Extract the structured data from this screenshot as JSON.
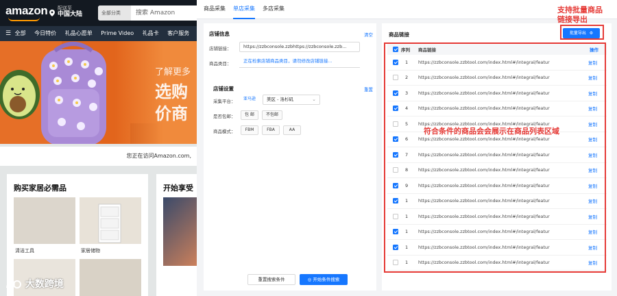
{
  "amazon": {
    "logo": "amazon",
    "deliver_label": "配送至",
    "deliver_location": "中国大陆",
    "category": "全部分类",
    "search_placeholder": "搜索 Amazon",
    "nav": [
      "全部",
      "今日特价",
      "礼品心愿单",
      "Prime Video",
      "礼品卡",
      "客户服务"
    ],
    "hero_line1": "了解更多",
    "hero_line2": "选购",
    "hero_line3": "价商",
    "visiting_text": "您正在访问Amazon.com,",
    "card1_title": "购买家居必需品",
    "card1_captions": [
      "清洁工具",
      "家居储物"
    ],
    "card2_title": "开始享受",
    "watermark": "大数跨境"
  },
  "tabs": [
    {
      "label": "商品采集",
      "active": false
    },
    {
      "label": "单店采集",
      "active": true
    },
    {
      "label": "多店采集",
      "active": false
    }
  ],
  "store_info": {
    "title": "店铺信息",
    "clear_link": "清空",
    "link_label": "店铺链接：",
    "link_value": "https://zzbconsole.zzbhttps://zzbconsole.zzb...",
    "category_label": "商品类目：",
    "category_value": "正在检索店铺商品类目，请勿修改店铺链接..."
  },
  "store_settings": {
    "title": "店铺设置",
    "reset_link": "重置",
    "platform_label": "采集平台：",
    "platform_value": "亚马逊",
    "region_value": "美区 - 洛杉矶",
    "free_shipping_label": "是否包邮：",
    "free_shipping_options": [
      "包 邮",
      "不包邮"
    ],
    "mode_label": "商品模式：",
    "mode_options": [
      "FBM",
      "FBA",
      "AA"
    ]
  },
  "buttons": {
    "reset": "重置搜索条件",
    "search": "开始条件搜索",
    "export": "批量导出"
  },
  "product_links": {
    "title": "商品链接",
    "headers": {
      "index": "序列",
      "link": "商品链接",
      "action": "操作"
    },
    "action_label": "复制",
    "rows": [
      {
        "checked": true,
        "index": "1",
        "url": "https://zzbconsole.zzbtool.com/index.html#/integral/featur"
      },
      {
        "checked": false,
        "index": "2",
        "url": "https://zzbconsole.zzbtool.com/index.html#/integral/featur"
      },
      {
        "checked": true,
        "index": "3",
        "url": "https://zzbconsole.zzbtool.com/index.html#/integral/featur"
      },
      {
        "checked": true,
        "index": "4",
        "url": "https://zzbconsole.zzbtool.com/index.html#/integral/featur"
      },
      {
        "checked": false,
        "index": "5",
        "url": "https://zzbconsole.zzbtool.com/index.html#/integral/featur"
      },
      {
        "checked": true,
        "index": "6",
        "url": "https://zzbconsole.zzbtool.com/index.html#/integral/featur"
      },
      {
        "checked": true,
        "index": "7",
        "url": "https://zzbconsole.zzbtool.com/index.html#/integral/featur"
      },
      {
        "checked": false,
        "index": "8",
        "url": "https://zzbconsole.zzbtool.com/index.html#/integral/featur"
      },
      {
        "checked": true,
        "index": "9",
        "url": "https://zzbconsole.zzbtool.com/index.html#/integral/featur"
      },
      {
        "checked": true,
        "index": "1",
        "url": "https://zzbconsole.zzbtool.com/index.html#/integral/featur"
      },
      {
        "checked": false,
        "index": "1",
        "url": "https://zzbconsole.zzbtool.com/index.html#/integral/featur"
      },
      {
        "checked": true,
        "index": "1",
        "url": "https://zzbconsole.zzbtool.com/index.html#/integral/featur"
      },
      {
        "checked": true,
        "index": "1",
        "url": "https://zzbconsole.zzbtool.com/index.html#/integral/featur"
      },
      {
        "checked": false,
        "index": "1",
        "url": "https://zzbconsole.zzbtool.com/index.html#/integral/featur"
      }
    ]
  },
  "annotations": {
    "export_note_line1": "支持批量商品",
    "export_note_line2": "链接导出",
    "table_note": "符合条件的商品会会展示在商品列表区域"
  },
  "colors": {
    "accent": "#1677ff",
    "annotation": "#e53935",
    "amazon_dark": "#131921"
  }
}
